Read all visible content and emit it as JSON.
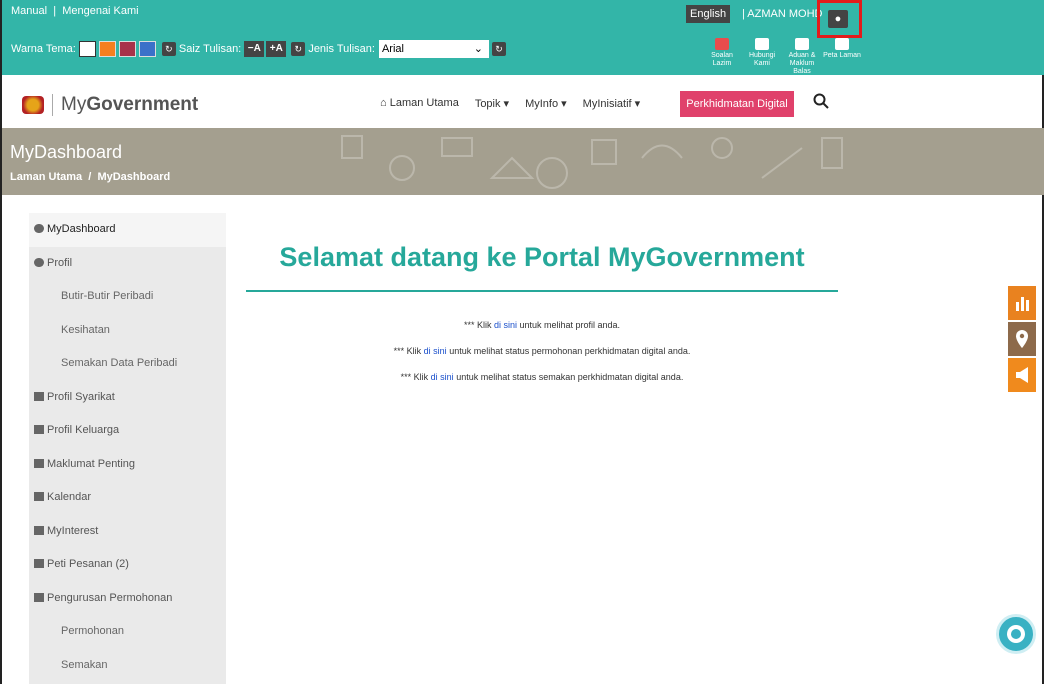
{
  "topbar": {
    "link_manual": "Manual",
    "link_sep": "|",
    "link_about": "Mengenai Kami",
    "theme_label": "Warna Tema:",
    "size_label": "Saiz Tulisan:",
    "size_minus": "−A",
    "size_plus": "+A",
    "font_label": "Jenis Tulisan:",
    "font_value": "Arial",
    "lang_button": "English",
    "user_name": "| AZMAN MOHD",
    "quick_links": [
      {
        "label": "Soalan Lazim"
      },
      {
        "label": "Hubungi Kami"
      },
      {
        "label": "Aduan & Maklum Balas"
      },
      {
        "label": "Peta Laman"
      }
    ]
  },
  "nav": {
    "logo_text_my": "My",
    "logo_text_gov": "Government",
    "items": [
      "Laman Utama",
      "Topik ▾",
      "MyInfo ▾",
      "MyInisiatif ▾"
    ],
    "digital_button": "Perkhidmatan Digital"
  },
  "banner": {
    "title": "MyDashboard",
    "crumb_home": "Laman Utama",
    "crumb_sep": "/",
    "crumb_current": "MyDashboard"
  },
  "sidebar": {
    "items": [
      {
        "label": "MyDashboard"
      },
      {
        "label": "Profil"
      },
      {
        "label": "Butir-Butir Peribadi"
      },
      {
        "label": "Kesihatan"
      },
      {
        "label": "Semakan Data Peribadi"
      },
      {
        "label": "Profil Syarikat"
      },
      {
        "label": "Profil Keluarga"
      },
      {
        "label": "Maklumat Penting"
      },
      {
        "label": "Kalendar"
      },
      {
        "label": "MyInterest"
      },
      {
        "label": "Peti Pesanan (2)"
      },
      {
        "label": "Pengurusan Permohonan"
      },
      {
        "label": "Permohonan"
      },
      {
        "label": "Semakan"
      }
    ]
  },
  "main": {
    "welcome": "Selamat datang ke Portal MyGovernment",
    "lines": [
      {
        "prefix": "*** Klik ",
        "link": "di sini",
        "suffix": " untuk melihat profil anda."
      },
      {
        "prefix": "*** Klik ",
        "link": "di sini",
        "suffix": " untuk melihat status permohonan perkhidmatan digital anda."
      },
      {
        "prefix": "*** Klik ",
        "link": "di sini",
        "suffix": " untuk melihat status semakan perkhidmatan digital anda."
      }
    ]
  },
  "colors": {
    "teal": "#33b5a8",
    "heading": "#26a89a",
    "digital": "#e0416b",
    "highlight": "#e31b1b"
  }
}
